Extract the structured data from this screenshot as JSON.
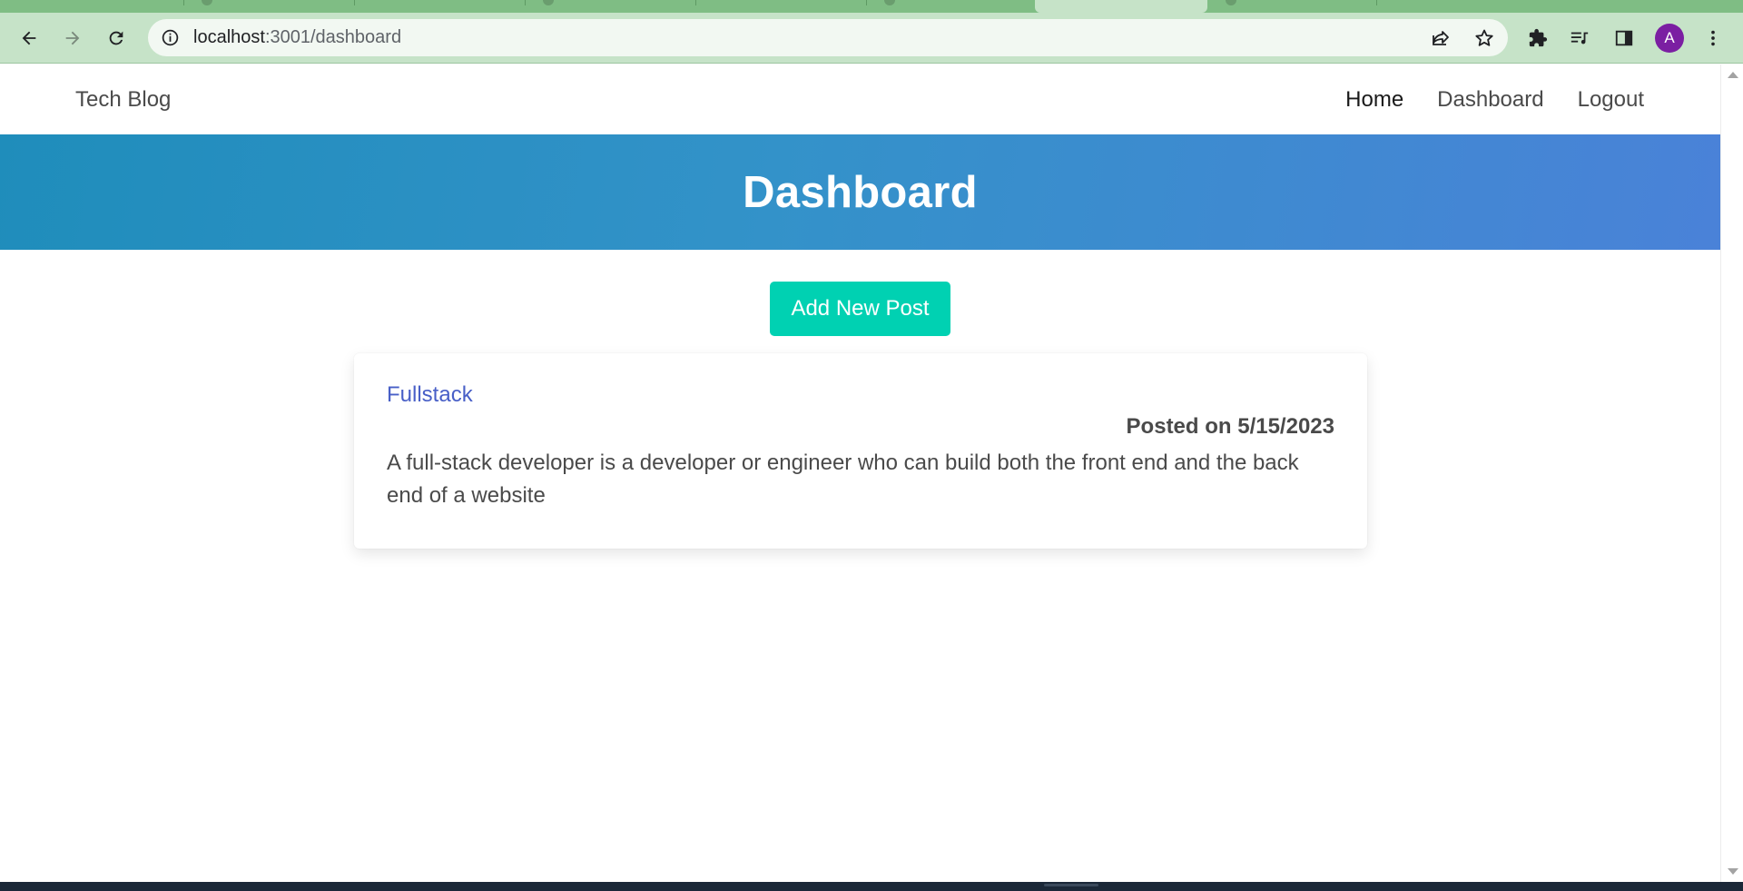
{
  "browser": {
    "url_host": "localhost",
    "url_path": ":3001/dashboard",
    "profile_initial": "A",
    "icons": {
      "back": "arrow-left-icon",
      "forward": "arrow-right-icon",
      "reload": "reload-icon",
      "site_info": "info-icon",
      "share": "share-icon",
      "bookmark": "star-icon",
      "extensions": "puzzle-icon",
      "reading_list": "reading-list-icon",
      "side_panel": "side-panel-icon",
      "menu": "kebab-menu-icon"
    },
    "colors": {
      "frame": "#c6e3c8",
      "tabstrip": "#7fbd84",
      "avatar": "#7b1fa2"
    }
  },
  "site": {
    "brand": "Tech Blog",
    "nav": {
      "home": "Home",
      "dashboard": "Dashboard",
      "logout": "Logout"
    }
  },
  "hero": {
    "title": "Dashboard",
    "gradient_start": "#1f8dbb",
    "gradient_end": "#4a82d8"
  },
  "actions": {
    "add_post": "Add New Post",
    "add_post_color": "#00d1b2"
  },
  "posts": [
    {
      "title": "Fullstack",
      "date_line": "Posted on 5/15/2023",
      "body": "A full-stack developer is a developer or engineer who can build both the front end and the back end of a website"
    }
  ]
}
